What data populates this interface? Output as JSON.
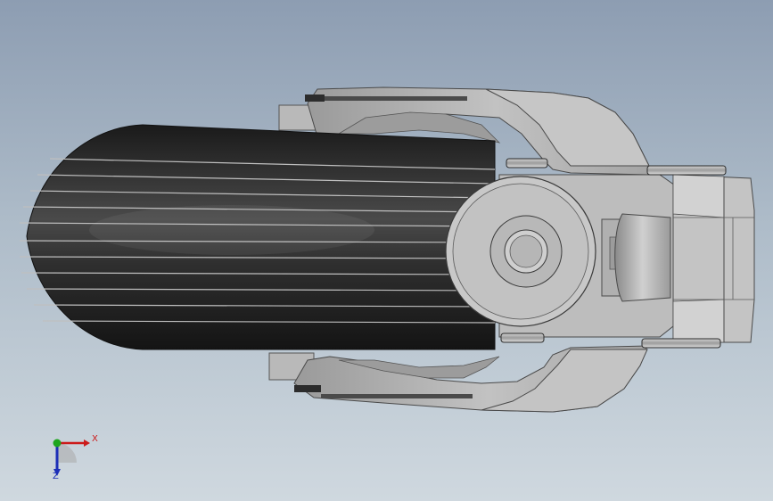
{
  "viewport": {
    "background_top": "#8d9db2",
    "background_bottom": "#cfd8df"
  },
  "model": {
    "roller_color": "#202020",
    "bracket_color": "#b4b4b4",
    "bracket_shadow_color": "#8e8e8e"
  },
  "triad": {
    "x_label": "X",
    "z_label": "Z",
    "x_color": "#cc1b1b",
    "y_color": "#1ea61e",
    "z_color": "#1d2fb8"
  }
}
